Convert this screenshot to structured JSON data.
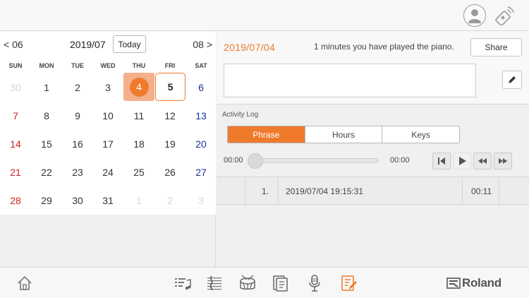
{
  "calendar": {
    "prev_label": "< 06",
    "month_label": "2019/07",
    "next_label": "08 >",
    "today_label": "Today",
    "weekdays": [
      "SUN",
      "MON",
      "TUE",
      "WED",
      "THU",
      "FRI",
      "SAT"
    ],
    "weeks": [
      [
        "30",
        "1",
        "2",
        "3",
        "4",
        "5",
        "6"
      ],
      [
        "7",
        "8",
        "9",
        "10",
        "11",
        "12",
        "13"
      ],
      [
        "14",
        "15",
        "16",
        "17",
        "18",
        "19",
        "20"
      ],
      [
        "21",
        "22",
        "23",
        "24",
        "25",
        "26",
        "27"
      ],
      [
        "28",
        "29",
        "30",
        "31",
        "1",
        "2",
        "3"
      ]
    ],
    "today_day": "4",
    "selected_day": "5"
  },
  "detail": {
    "date": "2019/07/04",
    "played_message": "1 minutes you have played the piano.",
    "share_label": "Share",
    "memo_text": ""
  },
  "activity": {
    "label": "Activity Log",
    "tabs": [
      "Phrase",
      "Hours",
      "Keys"
    ],
    "active_tab": "Phrase",
    "time_start": "00:00",
    "time_end": "00:00",
    "progress_fraction": 0
  },
  "log": [
    {
      "index": "1.",
      "datetime": "2019/07/04 19:15:31",
      "duration": "00:11"
    }
  ],
  "brand": {
    "name": "Roland"
  },
  "colors": {
    "accent": "#f07a2c",
    "today_bg": "#f4b08c",
    "sunday": "#d02020",
    "saturday": "#1a2f9a"
  },
  "icons": {
    "top": [
      "user-avatar-icon",
      "bluetooth-device-icon"
    ],
    "bottom": [
      "home-icon",
      "song-list-icon",
      "score-icon",
      "drum-icon",
      "sheet-music-icon",
      "microphone-icon",
      "diary-icon"
    ]
  }
}
